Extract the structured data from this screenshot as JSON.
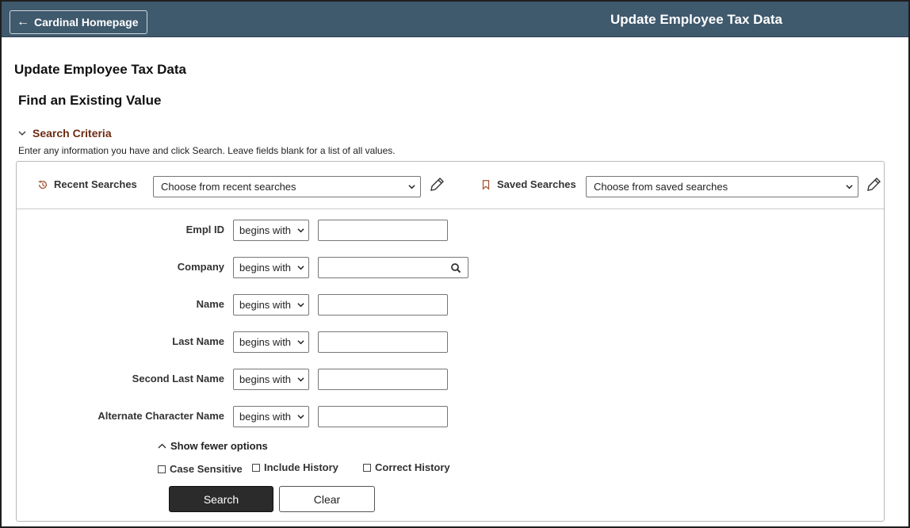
{
  "header": {
    "back_label": "Cardinal Homepage",
    "title": "Update Employee Tax Data"
  },
  "page": {
    "title": "Update Employee Tax Data",
    "subtitle": "Find an Existing Value"
  },
  "criteria": {
    "label": "Search Criteria",
    "instructions": "Enter any information you have and click Search. Leave fields blank for a list of all values."
  },
  "recent": {
    "label": "Recent Searches",
    "selected": "Choose from recent searches"
  },
  "saved": {
    "label": "Saved Searches",
    "selected": "Choose from saved searches"
  },
  "fields": [
    {
      "label": "Empl ID",
      "operator": "begins with",
      "value": ""
    },
    {
      "label": "Company",
      "operator": "begins with",
      "value": ""
    },
    {
      "label": "Name",
      "operator": "begins with",
      "value": ""
    },
    {
      "label": "Last Name",
      "operator": "begins with",
      "value": ""
    },
    {
      "label": "Second Last Name",
      "operator": "begins with",
      "value": ""
    },
    {
      "label": "Alternate Character Name",
      "operator": "begins with",
      "value": ""
    }
  ],
  "options": {
    "toggle_label": "Show fewer options",
    "case_sensitive": "Case Sensitive",
    "include_history": "Include History",
    "correct_history": "Correct History"
  },
  "actions": {
    "search": "Search",
    "clear": "Clear"
  },
  "icons": {
    "back": "arrow-left-icon",
    "criteria": "chevron-down-icon",
    "recent": "history-icon",
    "saved": "bookmark-icon",
    "edit": "pencil-icon",
    "lookup": "magnifier-icon",
    "toggle": "chevron-up-icon"
  },
  "colors": {
    "header_bg": "#3f596d",
    "criteria_link": "#6e2b12",
    "primary_button": "#2b2b2b"
  }
}
